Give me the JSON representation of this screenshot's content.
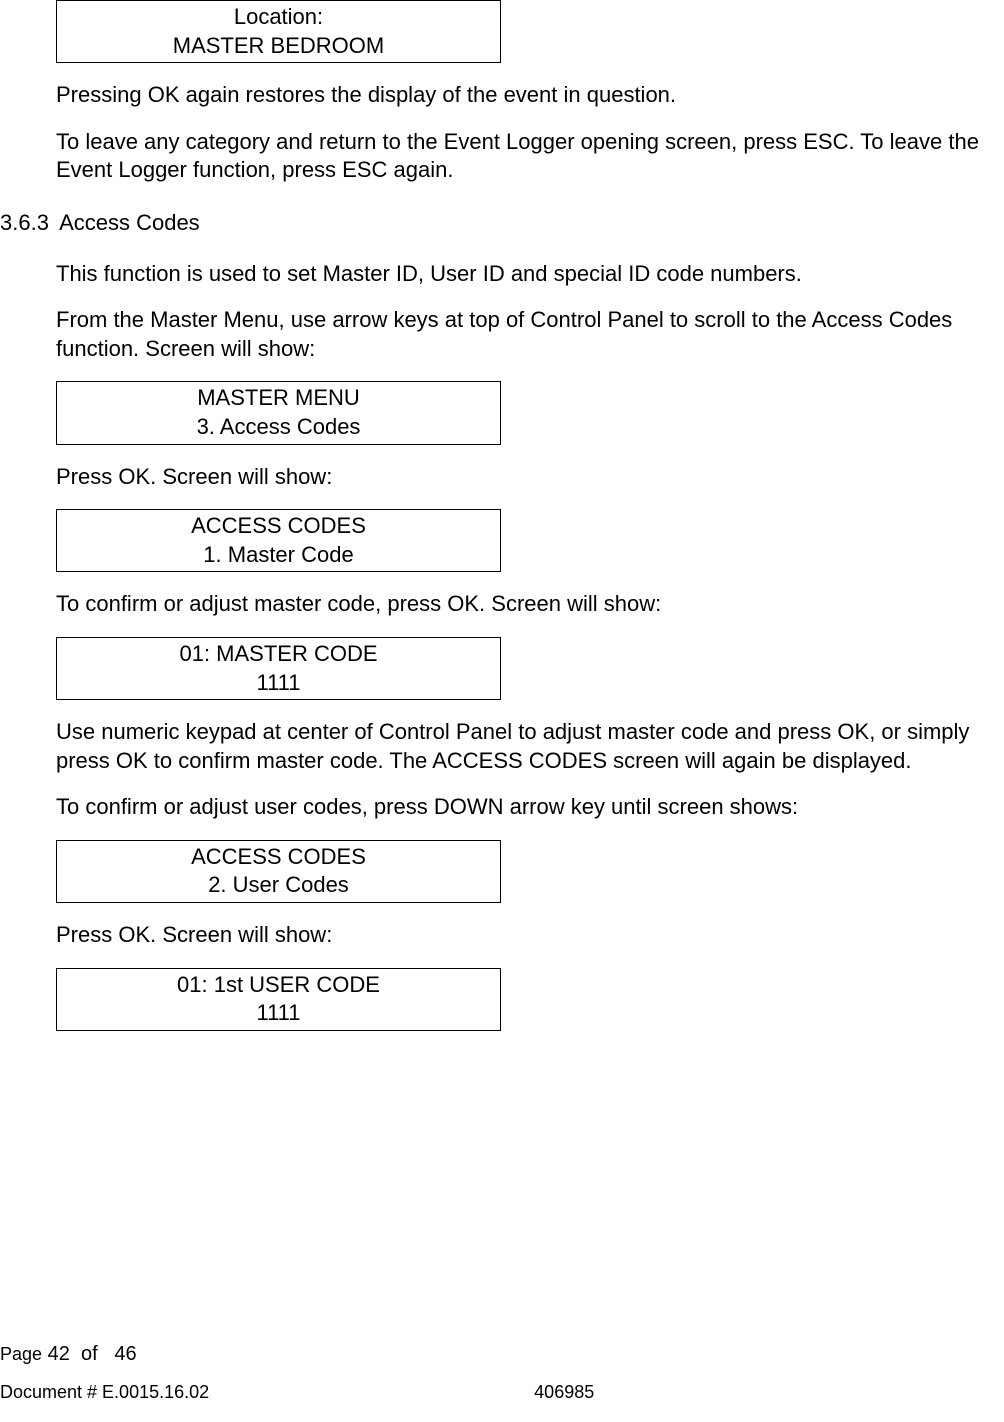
{
  "boxes": {
    "location": {
      "line1": "Location:",
      "line2": "MASTER BEDROOM"
    },
    "masterMenu": {
      "line1": "MASTER MENU",
      "line2": "3. Access Codes"
    },
    "accessCodes1": {
      "line1": "ACCESS CODES",
      "line2": "1. Master Code"
    },
    "masterCode": {
      "line1": "01: MASTER CODE",
      "line2": "1111"
    },
    "accessCodes2": {
      "line1": "ACCESS CODES",
      "line2": "2. User Codes"
    },
    "userCode": {
      "line1": "01: 1st USER CODE",
      "line2": "1111"
    }
  },
  "paragraphs": {
    "p1": "Pressing OK again restores the display of the event in question.",
    "p2": "To leave any category and return to the Event Logger opening screen, press ESC. To leave the Event Logger function, press ESC again.",
    "p3": "This function is used to set Master ID, User ID and special ID code numbers.",
    "p4": "From the Master Menu, use arrow keys at top of Control Panel to scroll to the Access Codes function. Screen will show:",
    "p5": "Press OK. Screen will show:",
    "p6": "To confirm or adjust master code, press OK. Screen will show:",
    "p7": "Use numeric keypad at center of Control Panel to adjust master code and press OK, or simply press OK to confirm master code. The ACCESS CODES screen will again be displayed.",
    "p8": "To confirm or adjust user codes, press DOWN arrow key until screen shows:",
    "p9": "Press OK. Screen will show:"
  },
  "section": {
    "number": "3.6.3",
    "title": "Access Codes"
  },
  "footer": {
    "pageWord": "Page",
    "pageNum": "42",
    "ofWord": "of",
    "totalPages": "46",
    "docLabel": "Document # E.0015.16.02",
    "docRight": "406985"
  }
}
